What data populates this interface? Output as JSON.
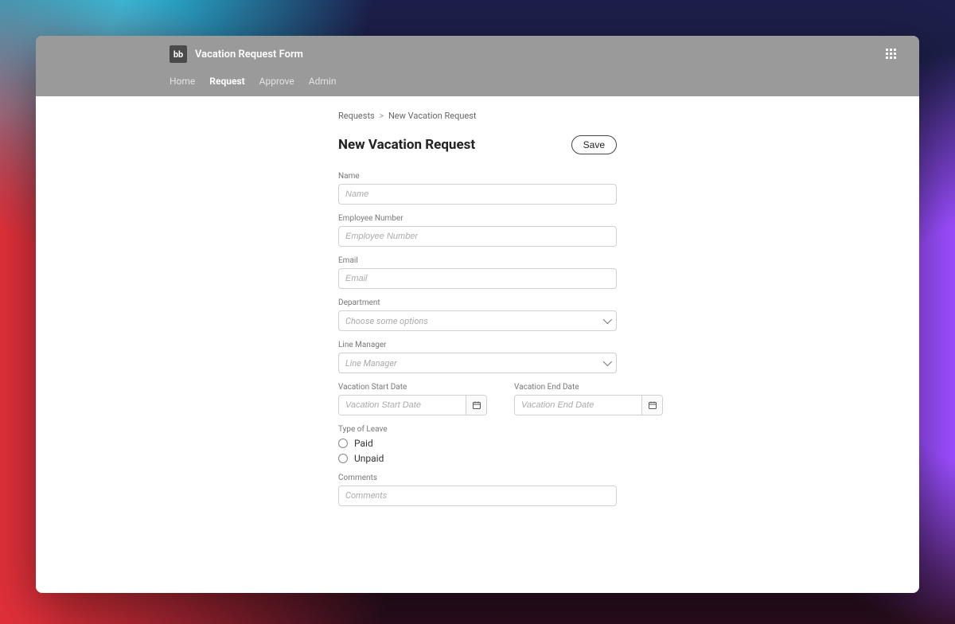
{
  "header": {
    "logo_text": "bb",
    "app_title": "Vacation Request Form",
    "nav": [
      {
        "label": "Home",
        "active": false
      },
      {
        "label": "Request",
        "active": true
      },
      {
        "label": "Approve",
        "active": false
      },
      {
        "label": "Admin",
        "active": false
      }
    ]
  },
  "breadcrumb": {
    "link": "Requests",
    "sep": ">",
    "current": "New Vacation Request"
  },
  "page": {
    "title": "New Vacation Request",
    "save_label": "Save"
  },
  "fields": {
    "name": {
      "label": "Name",
      "placeholder": "Name",
      "value": ""
    },
    "employee_number": {
      "label": "Employee Number",
      "placeholder": "Employee Number",
      "value": ""
    },
    "email": {
      "label": "Email",
      "placeholder": "Email",
      "value": ""
    },
    "department": {
      "label": "Department",
      "placeholder": "Choose some options",
      "value": ""
    },
    "line_manager": {
      "label": "Line Manager",
      "placeholder": "Line Manager",
      "value": ""
    },
    "start_date": {
      "label": "Vacation Start Date",
      "placeholder": "Vacation Start Date",
      "value": ""
    },
    "end_date": {
      "label": "Vacation End Date",
      "placeholder": "Vacation End Date",
      "value": ""
    },
    "type_of_leave": {
      "label": "Type of Leave",
      "options": [
        "Paid",
        "Unpaid"
      ],
      "value": ""
    },
    "comments": {
      "label": "Comments",
      "placeholder": "Comments",
      "value": ""
    }
  }
}
